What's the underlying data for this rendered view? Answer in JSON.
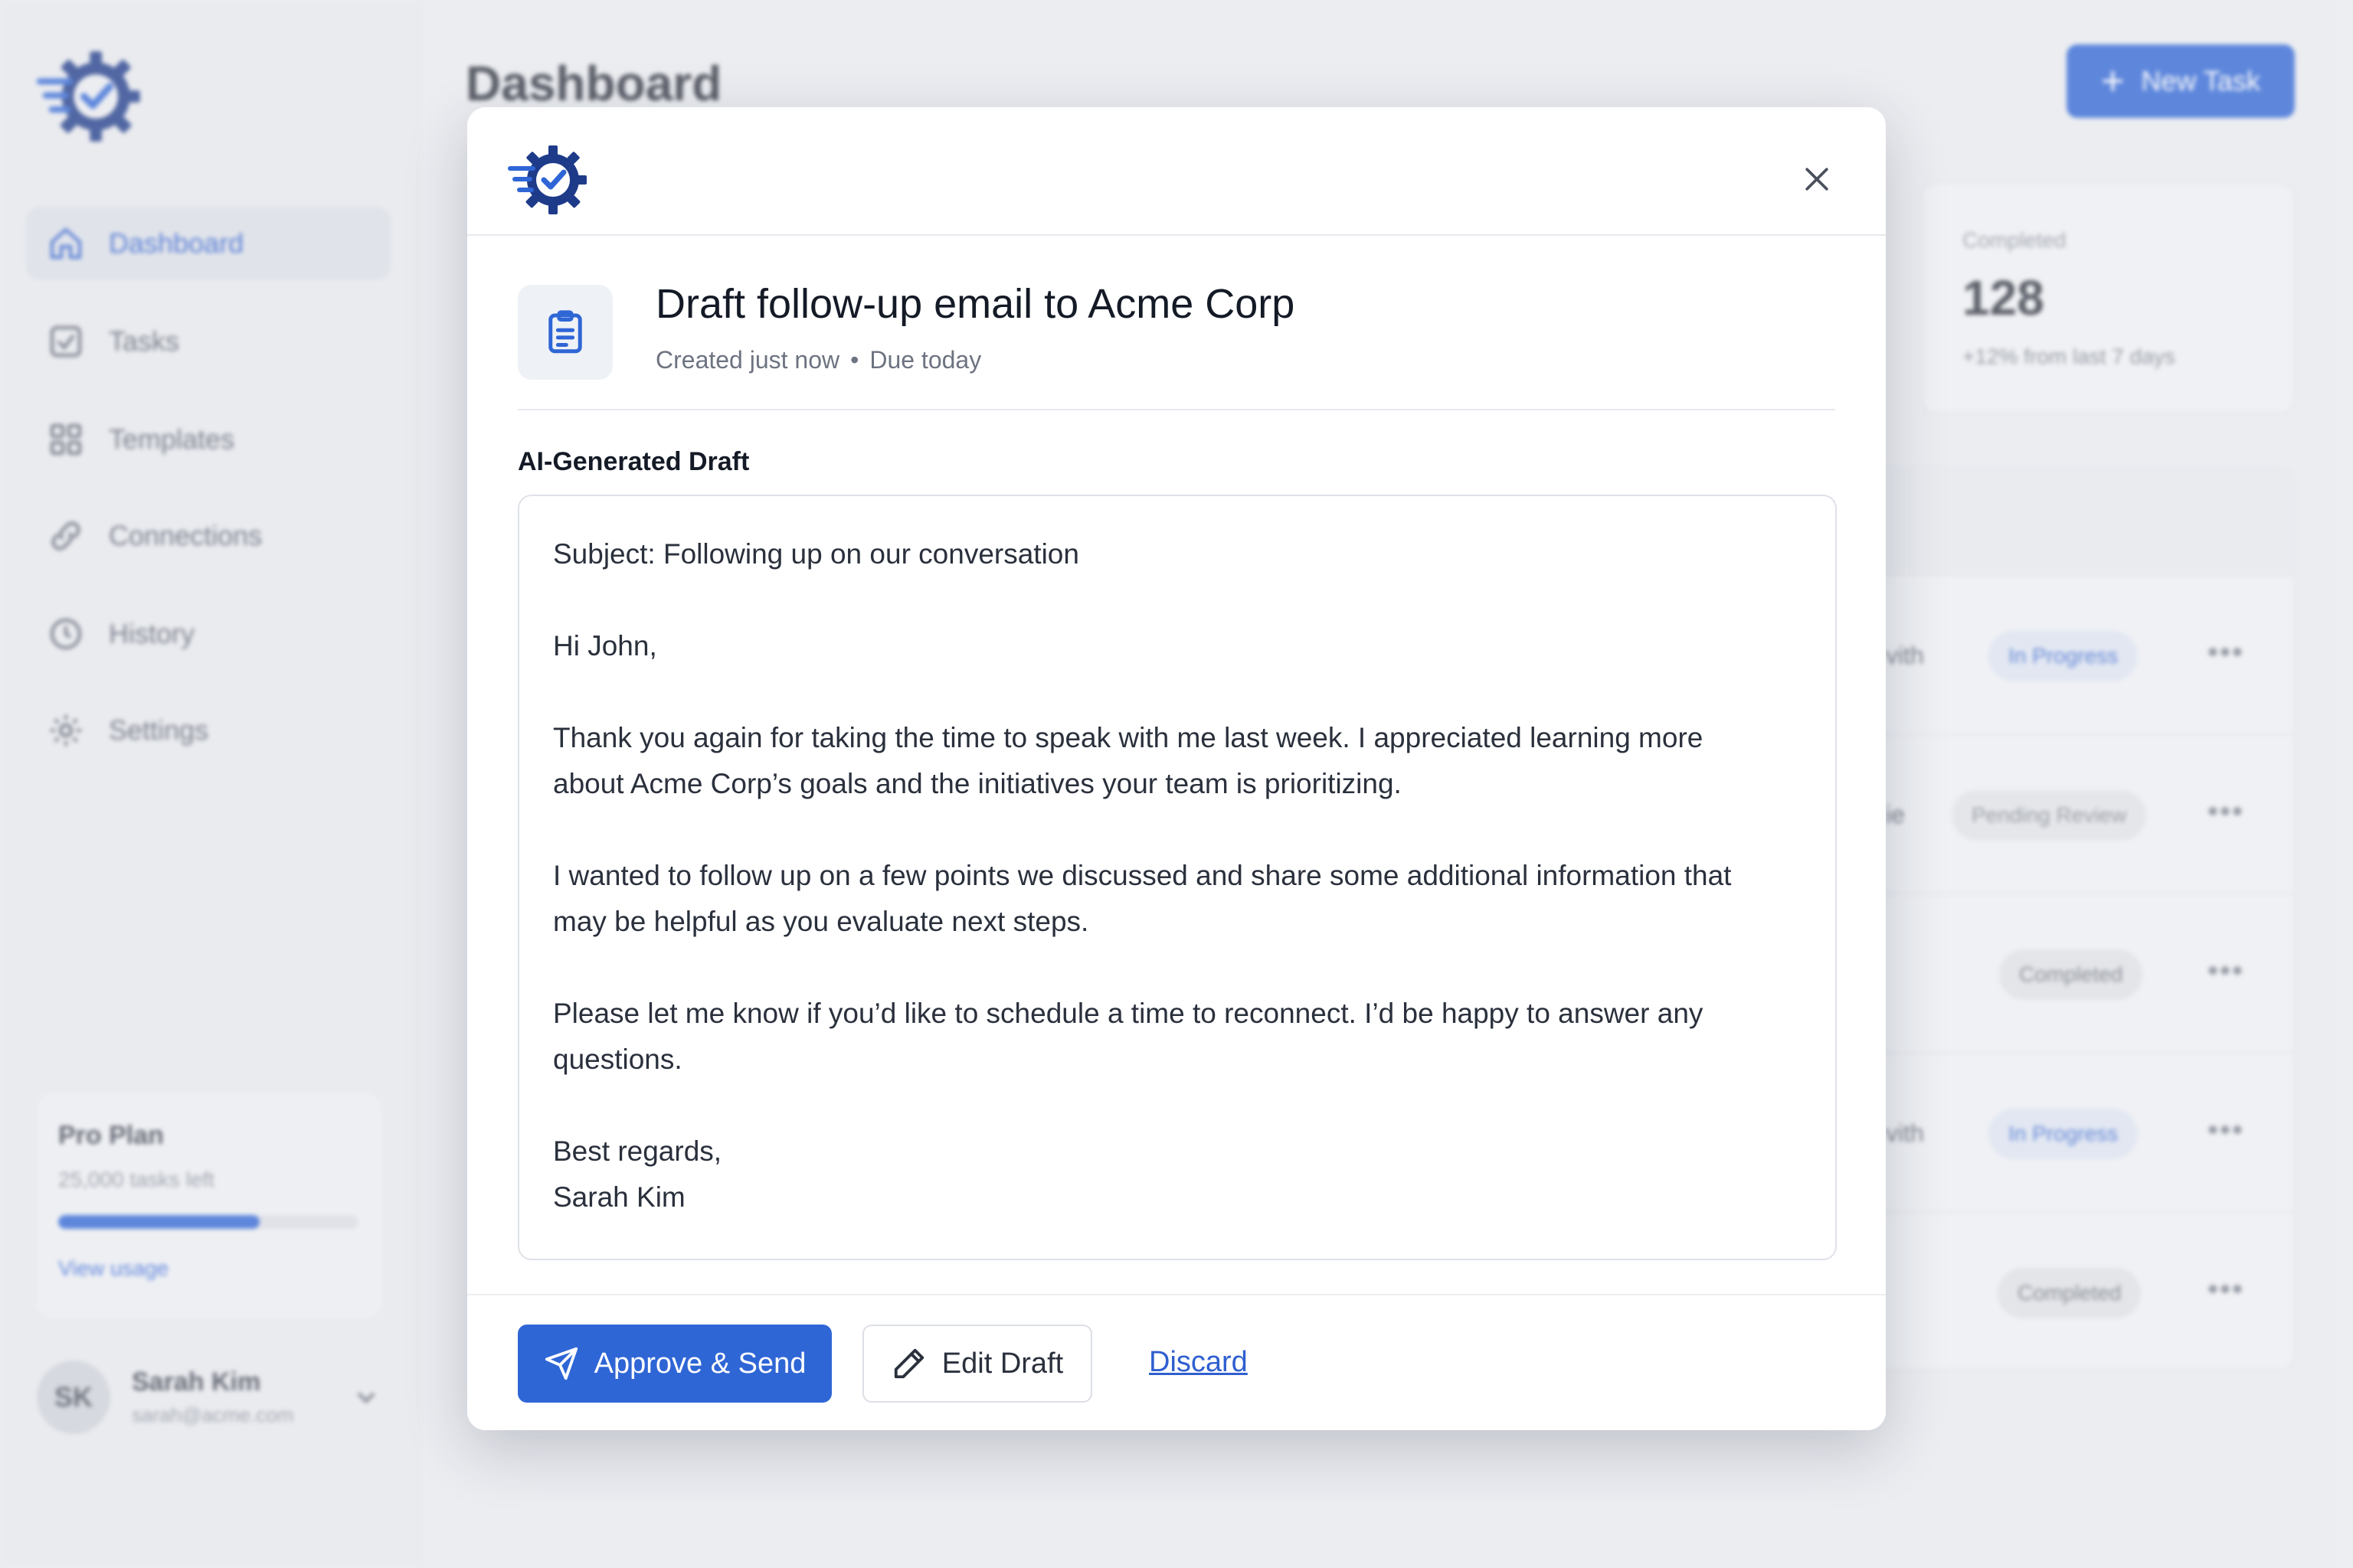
{
  "app": {
    "page_title": "Dashboard",
    "new_task_label": "New Task",
    "sidebar": {
      "items": [
        {
          "label": "Dashboard",
          "icon": "home-icon",
          "active": true
        },
        {
          "label": "Tasks",
          "icon": "checkbox-icon"
        },
        {
          "label": "Templates",
          "icon": "grid-icon"
        },
        {
          "label": "Connections",
          "icon": "link-icon"
        },
        {
          "label": "History",
          "icon": "clock-icon"
        },
        {
          "label": "Settings",
          "icon": "gear-icon"
        }
      ],
      "plan": {
        "title": "Pro Plan",
        "subtitle": "25,000 tasks left",
        "usage_fraction": 0.67,
        "link": "View usage"
      },
      "user": {
        "initials": "SK",
        "name": "Sarah Kim",
        "email": "sarah@acme.com"
      }
    },
    "stats": {
      "label": "Completed",
      "value": "128",
      "change": "+12% from last 7 days"
    },
    "rows": [
      {
        "fragment": "vith",
        "status": "In Progress"
      },
      {
        "fragment": "ie",
        "status": "Pending Review"
      },
      {
        "fragment": "",
        "status": "Completed"
      },
      {
        "fragment": "vith",
        "status": "In Progress"
      },
      {
        "fragment": "",
        "status": "Completed"
      }
    ],
    "row_menu": "•••"
  },
  "modal": {
    "title": "Draft follow-up email to Acme Corp",
    "meta_created": "Created just now",
    "meta_sep": "•",
    "meta_due": "Due today",
    "draft_label": "AI-Generated Draft",
    "draft": {
      "subject": "Subject: Following up on our conversation",
      "greeting": "Hi John,",
      "para1": "Thank you again for taking the time to speak with me last week. I appreciated learning more about Acme Corp’s goals and the initiatives your team is prioritizing.",
      "para2": "I wanted to follow up on a few points we discussed and share some additional information that may be helpful as you evaluate next steps.",
      "para3": "Please let me know if you’d like to schedule a time to reconnect. I’d be happy to answer any questions.",
      "closing": "Best regards,",
      "signature": "Sarah Kim"
    },
    "actions": {
      "approve": "Approve & Send",
      "edit": "Edit Draft",
      "discard": "Discard"
    }
  },
  "colors": {
    "accent": "#2f66d6",
    "logo_dark": "#1e3b8a",
    "logo_light": "#2f66d6"
  }
}
